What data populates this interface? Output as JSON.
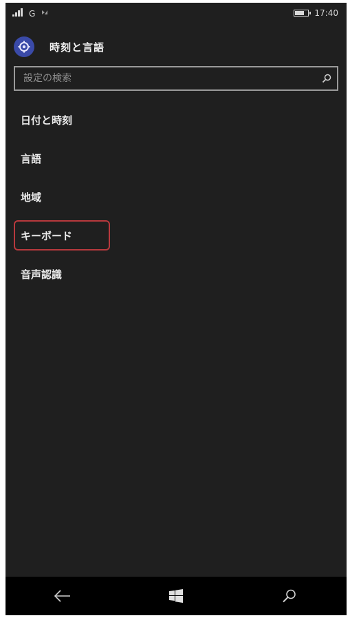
{
  "status_bar": {
    "signal_icon": "signal-icon",
    "network_label": "G",
    "sync_icon": "sync-icon",
    "battery_icon": "battery-icon",
    "time": "17:40"
  },
  "header": {
    "icon": "settings-gear-icon",
    "title": "時刻と言語"
  },
  "search": {
    "placeholder": "設定の検索",
    "icon": "search-icon"
  },
  "menu": {
    "items": [
      {
        "label": "日付と時刻",
        "highlighted": false
      },
      {
        "label": "言語",
        "highlighted": false
      },
      {
        "label": "地域",
        "highlighted": false
      },
      {
        "label": "キーボード",
        "highlighted": true
      },
      {
        "label": "音声認識",
        "highlighted": false
      }
    ]
  },
  "nav_bar": {
    "back_icon": "back-arrow-icon",
    "home_icon": "windows-start-icon",
    "search_icon": "search-icon"
  },
  "colors": {
    "background": "#1f1f1f",
    "accent": "#3a4aa8",
    "highlight_border": "#b8393d",
    "nav_background": "#000000"
  }
}
